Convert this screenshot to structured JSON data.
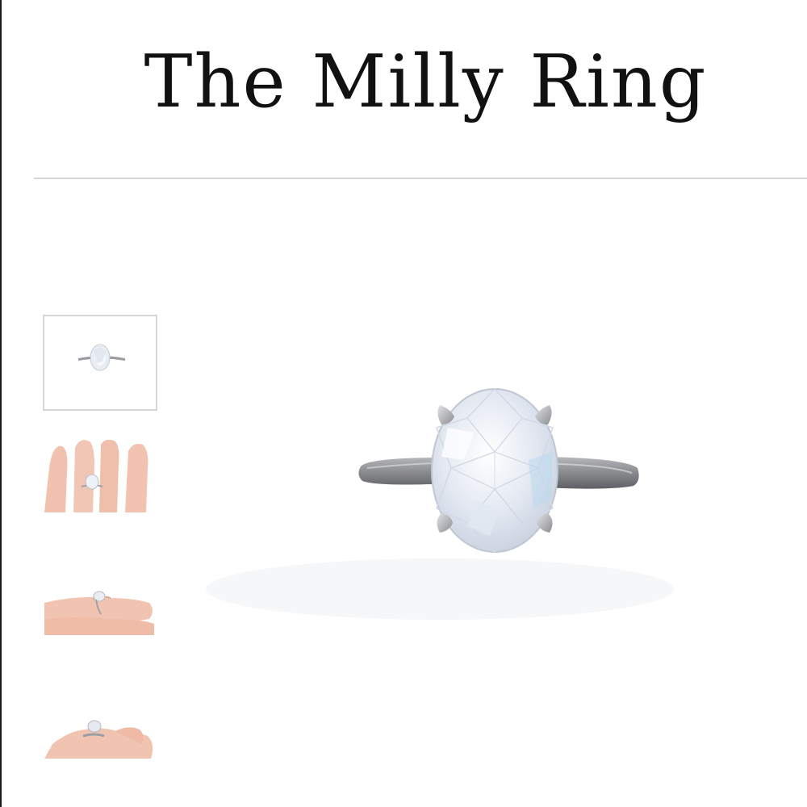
{
  "product": {
    "title": "The Milly Ring"
  },
  "gallery": {
    "thumbnails": [
      {
        "icon": "ring-product-photo",
        "selected": true
      },
      {
        "icon": "ring-on-hand-front-photo",
        "selected": false
      },
      {
        "icon": "ring-on-hand-side-photo",
        "selected": false
      },
      {
        "icon": "ring-on-hand-angle-photo",
        "selected": false
      }
    ],
    "main_image": {
      "icon": "oval-solitaire-ring-photo"
    }
  },
  "colors": {
    "title_text": "#111111",
    "divider": "#d6d6d6",
    "selected_thumb_border": "#d6d6d6",
    "left_edge": "#1a1a1a"
  }
}
